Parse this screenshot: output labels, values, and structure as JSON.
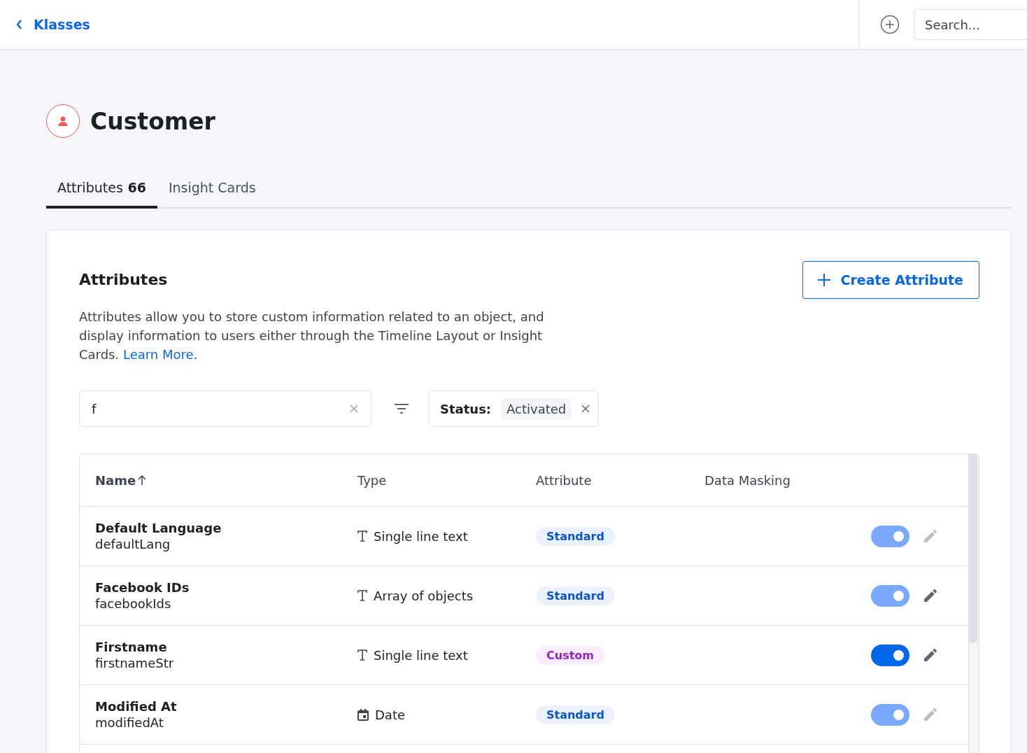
{
  "topbar": {
    "back_link": "Klasses",
    "search": {
      "placeholder": "Search..."
    }
  },
  "header": {
    "title": "Customer"
  },
  "tabs": [
    {
      "label": "Attributes",
      "count": "66",
      "selected": true
    },
    {
      "label": "Insight Cards",
      "selected": false
    }
  ],
  "panel": {
    "title": "Attributes",
    "create_button": "Create Attribute",
    "description": "Attributes allow you to store custom information related to an object, and display information to users either through the Timeline Layout or Insight Cards.",
    "learn_more": "Learn More",
    "description_end": ".",
    "filter": {
      "value": "f"
    },
    "status_chip": {
      "label": "Status:",
      "value": "Activated"
    }
  },
  "table": {
    "columns": [
      {
        "label": "Name",
        "sorted": true
      },
      {
        "label": "Type",
        "sorted": false
      },
      {
        "label": "Attribute",
        "sorted": false
      },
      {
        "label": "Data Masking",
        "sorted": false
      }
    ],
    "rows": [
      {
        "name": "Default Language",
        "key": "defaultLang",
        "type": {
          "kind": "text",
          "label": "Single line text"
        },
        "attribute": {
          "kind": "standard",
          "label": "Standard"
        },
        "on": true,
        "toggle_disabled": true,
        "edit_disabled": true
      },
      {
        "name": "Facebook IDs",
        "key": "facebookIds",
        "type": {
          "kind": "text",
          "label": "Array of objects"
        },
        "attribute": {
          "kind": "standard",
          "label": "Standard"
        },
        "on": true,
        "toggle_disabled": true,
        "edit_disabled": false
      },
      {
        "name": "Firstname",
        "key": "firstnameStr",
        "type": {
          "kind": "text",
          "label": "Single line text"
        },
        "attribute": {
          "kind": "custom",
          "label": "Custom"
        },
        "on": true,
        "toggle_disabled": false,
        "edit_disabled": false
      },
      {
        "name": "Modified At",
        "key": "modifiedAt",
        "type": {
          "kind": "date",
          "label": "Date"
        },
        "attribute": {
          "kind": "standard",
          "label": "Standard"
        },
        "on": true,
        "toggle_disabled": true,
        "edit_disabled": true
      }
    ]
  }
}
